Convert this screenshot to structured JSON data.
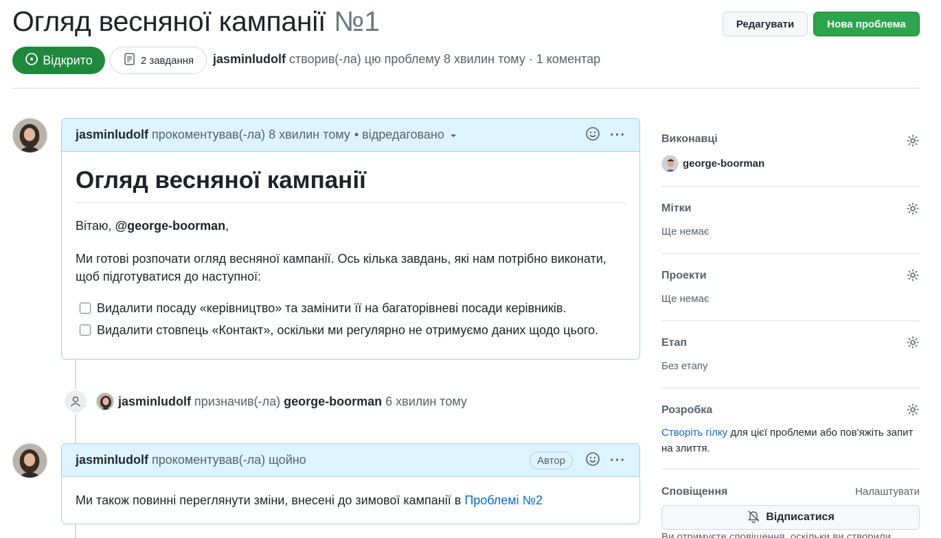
{
  "header": {
    "title": "Огляд весняної кампанії",
    "number": "№1",
    "edit_label": "Редагувати",
    "new_issue_label": "Нова проблема",
    "state_label": "Відкрито",
    "tasks_label": "2 завдання",
    "meta_author": "jasminludolf",
    "meta_text": "створив(-ла) цю проблему 8 хвилин тому · 1 коментар"
  },
  "comment1": {
    "author": "jasminludolf",
    "action": "прокоментував(-ла) 8 хвилин тому",
    "edited": "• відредаговано",
    "heading": "Огляд весняної кампанії",
    "greeting_prefix": "Вітаю, ",
    "mention": "@george-boorman",
    "greeting_suffix": ",",
    "paragraph": "Ми готові розпочати огляд весняної кампанії. Ось кілька завдань, які нам потрібно виконати, щоб підготуватися до наступної:",
    "tasks": [
      "Видалити посаду «керівництво» та замінити її на багаторівневі посади керівників.",
      "Видалити стовпець «Контакт», оскільки ми регулярно не отримуємо даних щодо цього."
    ]
  },
  "event": {
    "actor": "jasminludolf",
    "action": "призначив(-ла)",
    "target": "george-boorman",
    "time": "6 хвилин тому"
  },
  "comment2": {
    "author": "jasminludolf",
    "action": "прокоментував(-ла) щойно",
    "badge": "Автор",
    "text": "Ми також повинні переглянути зміни, внесені до зимової кампанії в ",
    "link": "Проблемі №2"
  },
  "sidebar": {
    "assignees_title": "Виконавці",
    "assignee": "george-boorman",
    "labels_title": "Мітки",
    "labels_value": "Ще немає",
    "projects_title": "Проекти",
    "projects_value": "Ще немає",
    "milestone_title": "Етап",
    "milestone_value": "Без етапу",
    "development_title": "Розробка",
    "development_link": "Створіть гілку",
    "development_text": " для цієї проблеми або пов'яжіть запит на злиття.",
    "notifications_title": "Сповіщення",
    "notifications_customize": "Налаштувати",
    "unsubscribe_label": "Відписатися",
    "notifications_note": "Ви отримуєте сповіщення, оскільки ви створили"
  },
  "icons": [
    "issue-open-icon",
    "tasklist-icon",
    "smiley-icon",
    "kebab-icon",
    "caret-down-icon",
    "person-icon",
    "gear-icon",
    "bell-slash-icon"
  ],
  "colors": {
    "accent_green": "#1f883d",
    "link_blue": "#0969da",
    "comment_header": "#ddf4ff"
  }
}
